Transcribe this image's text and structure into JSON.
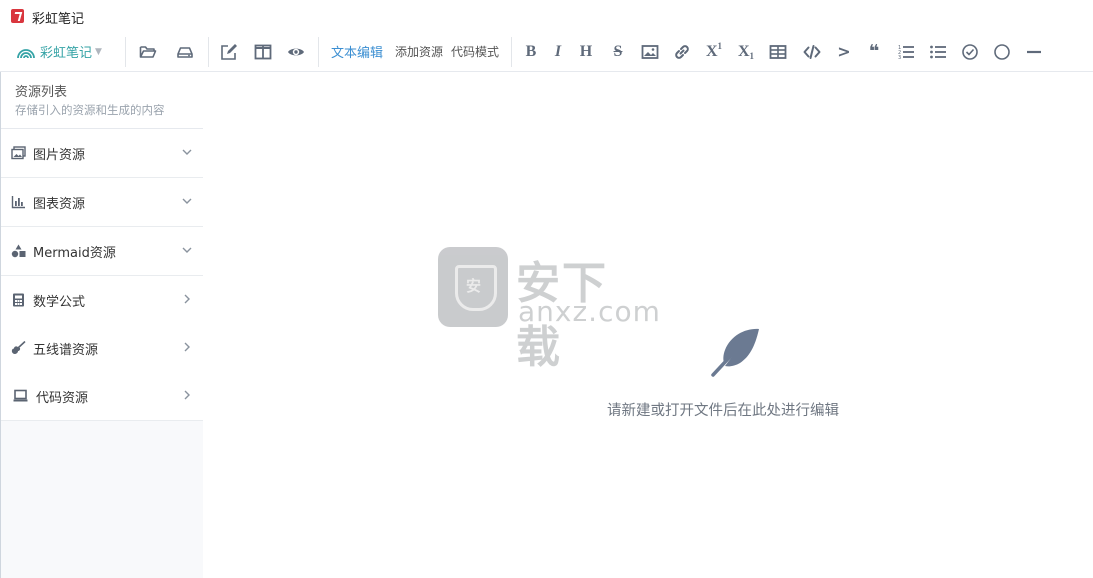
{
  "window": {
    "title": "彩虹笔记"
  },
  "toolbar": {
    "brand_label": "彩虹笔记",
    "brand_caret": "▼",
    "tabs": [
      "文本编辑",
      "添加资源",
      "代码模式"
    ],
    "format": {
      "bold": "B",
      "italic": "I",
      "heading": "H",
      "strike": "S",
      "sup_base": "X",
      "sup_mark": "1",
      "sub_base": "X",
      "sub_mark": "1",
      "quote_gt": ">",
      "quote_mark": "❝"
    }
  },
  "sidebar": {
    "title": "资源列表",
    "subtitle": "存储引入的资源和生成的内容",
    "items": [
      {
        "label": "图片资源",
        "icon": "image-icon",
        "expanded": true
      },
      {
        "label": "图表资源",
        "icon": "bar-chart-icon",
        "expanded": true
      },
      {
        "label": "Mermaid资源",
        "icon": "shapes-icon",
        "expanded": true
      },
      {
        "label": "数学公式",
        "icon": "calculator-icon",
        "expanded": false
      },
      {
        "label": "五线谱资源",
        "icon": "guitar-icon",
        "expanded": false
      },
      {
        "label": "代码资源",
        "icon": "laptop-icon",
        "expanded": false
      }
    ]
  },
  "main": {
    "empty_hint": "请新建或打开文件后在此处进行编辑",
    "watermark_text": "安下载",
    "watermark_domain": "anxz.com",
    "watermark_shield": "安"
  },
  "colors": {
    "brand": "#35a3a6",
    "active_tab": "#3c8fd2",
    "app_logo": "#d9363e",
    "feather": "#6b7a92"
  }
}
